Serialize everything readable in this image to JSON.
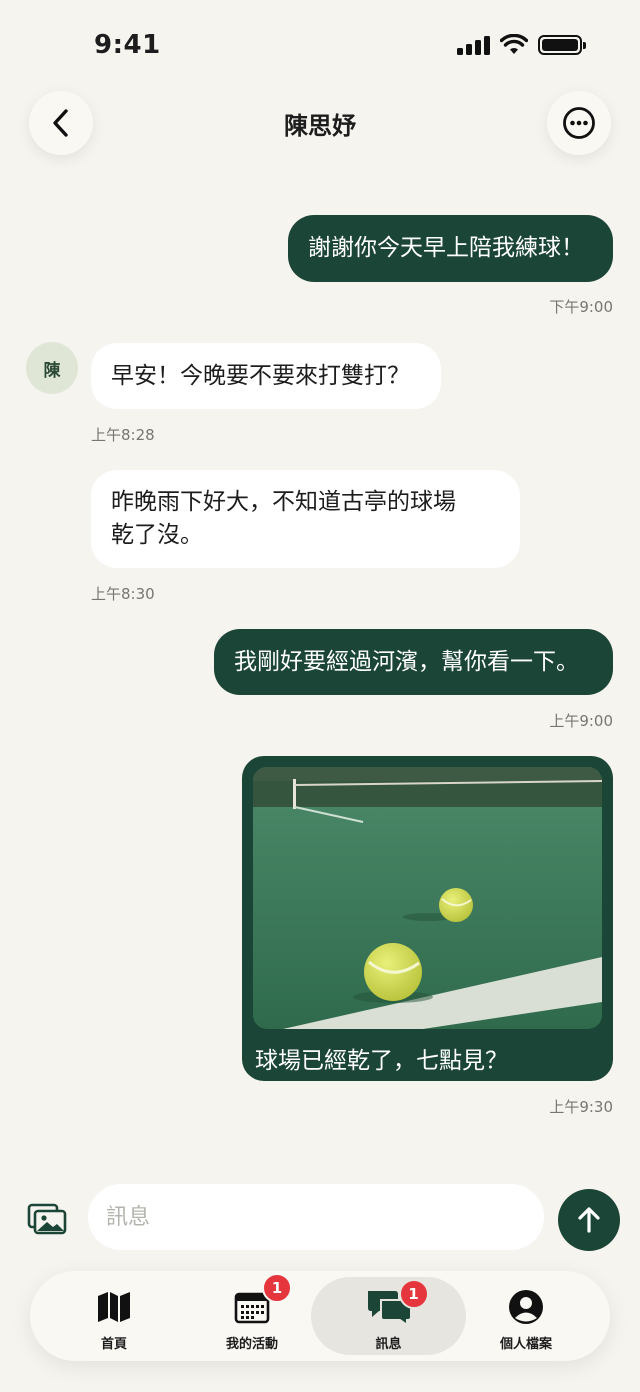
{
  "status_bar": {
    "time": "9:41"
  },
  "header": {
    "title": "陳思妤",
    "back_icon": "chevron-left-icon",
    "more_icon": "ellipsis-circle-icon"
  },
  "contact": {
    "avatar_initial": "陳"
  },
  "messages": [
    {
      "direction": "outgoing",
      "text": "謝謝你今天早上陪我練球！",
      "time": "下午9:00"
    },
    {
      "direction": "incoming",
      "text": "早安！今晚要不要來打雙打？",
      "time": "上午8:28"
    },
    {
      "direction": "incoming",
      "text_line1": "昨晚雨下好大，不知道古亭的球場",
      "text_line2": "乾了沒。",
      "time": "上午8:30"
    },
    {
      "direction": "outgoing",
      "text": "我剛好要經過河濱，幫你看一下。",
      "time": "上午9:00"
    },
    {
      "direction": "outgoing",
      "type": "image",
      "caption": "球場已經乾了，七點見？",
      "time": "上午9:30"
    }
  ],
  "composer": {
    "placeholder": "訊息",
    "value": "",
    "gallery_icon": "photo-gallery-icon",
    "send_icon": "arrow-up-icon"
  },
  "tab_bar": {
    "items": [
      {
        "label": "首頁",
        "icon": "map-icon",
        "badge": null,
        "active": false
      },
      {
        "label": "我的活動",
        "icon": "calendar-icon",
        "badge": "1",
        "active": false
      },
      {
        "label": "訊息",
        "icon": "chat-bubbles-icon",
        "badge": "1",
        "active": true
      },
      {
        "label": "個人檔案",
        "icon": "person-circle-icon",
        "badge": null,
        "active": false
      }
    ]
  },
  "colors": {
    "background": "#f6f4ef",
    "accent": "#1b4536",
    "badge": "#e5353d",
    "incoming_bubble": "#ffffff"
  }
}
